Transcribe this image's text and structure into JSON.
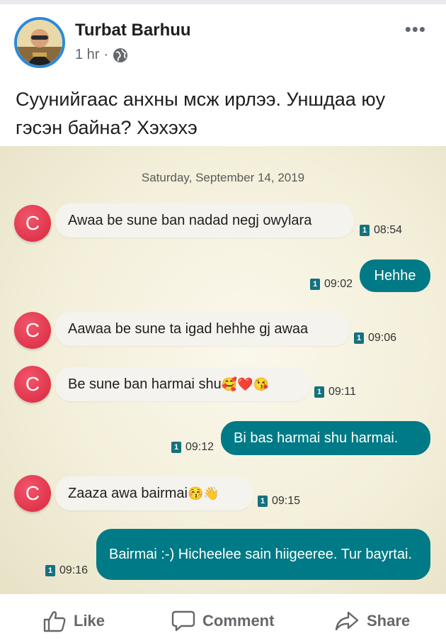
{
  "post": {
    "author": "Turbat Barhuu",
    "time": "1 hr",
    "separator": "·",
    "more": "•••",
    "text": "Суунийгаас анхны мсж ирлээ. Уншдаа юу гэсэн байна? Хэхэхэ"
  },
  "chat": {
    "date": "Saturday, September 14, 2019",
    "sim_label": "1",
    "contact_initial": "C",
    "messages": [
      {
        "dir": "in",
        "text": "Awaa be sune ban nadad negj owylara",
        "time": "08:54"
      },
      {
        "dir": "out",
        "text": "Hehhe",
        "time": "09:02"
      },
      {
        "dir": "in",
        "text": "Aawaa be sune ta igad hehhe gj awaa",
        "time": "09:06"
      },
      {
        "dir": "in",
        "text": "Be sune ban harmai shu",
        "emoji": "🥰❤️😘",
        "time": "09:11"
      },
      {
        "dir": "out",
        "text": "Bi bas harmai shu harmai.",
        "time": "09:12"
      },
      {
        "dir": "in",
        "text": "Zaaza awa bairmai",
        "emoji": "😚👋",
        "time": "09:15"
      },
      {
        "dir": "out",
        "text": "Bairmai :-) Hicheelee sain hiigeeree. Tur bayrtai.",
        "time": "09:16"
      }
    ]
  },
  "actions": {
    "like": "Like",
    "comment": "Comment",
    "share": "Share"
  },
  "colors": {
    "accent": "#2a8ad8",
    "outgoing_bubble": "#007a86",
    "contact_avatar": "#e0344a",
    "text_secondary": "#65676b"
  }
}
